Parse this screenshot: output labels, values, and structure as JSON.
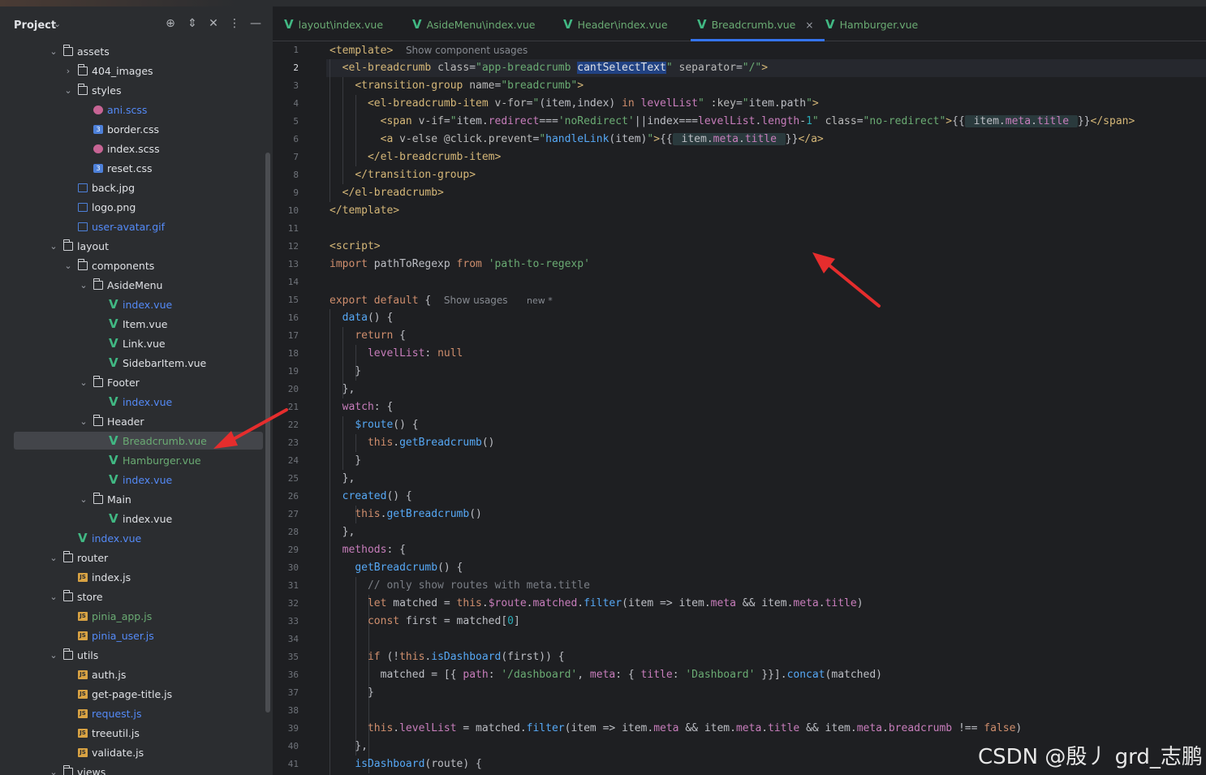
{
  "project": {
    "title": "Project",
    "tree": [
      {
        "label": "assets",
        "kind": "folder",
        "depth": 0,
        "open": true,
        "color": "default"
      },
      {
        "label": "404_images",
        "kind": "folder",
        "depth": 1,
        "open": false,
        "color": "default"
      },
      {
        "label": "styles",
        "kind": "folder",
        "depth": 1,
        "open": true,
        "color": "default"
      },
      {
        "label": "ani.scss",
        "kind": "scss",
        "depth": 2,
        "color": "blue"
      },
      {
        "label": "border.css",
        "kind": "css",
        "depth": 2,
        "color": "default"
      },
      {
        "label": "index.scss",
        "kind": "scss",
        "depth": 2,
        "color": "default"
      },
      {
        "label": "reset.css",
        "kind": "css",
        "depth": 2,
        "color": "default"
      },
      {
        "label": "back.jpg",
        "kind": "img",
        "depth": 1,
        "color": "default"
      },
      {
        "label": "logo.png",
        "kind": "img",
        "depth": 1,
        "color": "default"
      },
      {
        "label": "user-avatar.gif",
        "kind": "img",
        "depth": 1,
        "color": "blue"
      },
      {
        "label": "layout",
        "kind": "folder",
        "depth": 0,
        "open": true,
        "color": "default"
      },
      {
        "label": "components",
        "kind": "folder",
        "depth": 1,
        "open": true,
        "color": "default"
      },
      {
        "label": "AsideMenu",
        "kind": "folder",
        "depth": 2,
        "open": true,
        "color": "default"
      },
      {
        "label": "index.vue",
        "kind": "vue",
        "depth": 3,
        "color": "blue"
      },
      {
        "label": "Item.vue",
        "kind": "vue",
        "depth": 3,
        "color": "default"
      },
      {
        "label": "Link.vue",
        "kind": "vue",
        "depth": 3,
        "color": "default"
      },
      {
        "label": "SidebarItem.vue",
        "kind": "vue",
        "depth": 3,
        "color": "default"
      },
      {
        "label": "Footer",
        "kind": "folder",
        "depth": 2,
        "open": true,
        "color": "default"
      },
      {
        "label": "index.vue",
        "kind": "vue",
        "depth": 3,
        "color": "blue"
      },
      {
        "label": "Header",
        "kind": "folder",
        "depth": 2,
        "open": true,
        "color": "default"
      },
      {
        "label": "Breadcrumb.vue",
        "kind": "vue",
        "depth": 3,
        "color": "green",
        "selected": true
      },
      {
        "label": "Hamburger.vue",
        "kind": "vue",
        "depth": 3,
        "color": "green"
      },
      {
        "label": "index.vue",
        "kind": "vue",
        "depth": 3,
        "color": "blue"
      },
      {
        "label": "Main",
        "kind": "folder",
        "depth": 2,
        "open": true,
        "color": "default"
      },
      {
        "label": "index.vue",
        "kind": "vue",
        "depth": 3,
        "color": "default"
      },
      {
        "label": "index.vue",
        "kind": "vue",
        "depth": 1,
        "color": "blue"
      },
      {
        "label": "router",
        "kind": "folder",
        "depth": 0,
        "open": true,
        "color": "default"
      },
      {
        "label": "index.js",
        "kind": "js",
        "depth": 1,
        "color": "default"
      },
      {
        "label": "store",
        "kind": "folder",
        "depth": 0,
        "open": true,
        "color": "default"
      },
      {
        "label": "pinia_app.js",
        "kind": "js",
        "depth": 1,
        "color": "green"
      },
      {
        "label": "pinia_user.js",
        "kind": "js",
        "depth": 1,
        "color": "blue"
      },
      {
        "label": "utils",
        "kind": "folder",
        "depth": 0,
        "open": true,
        "color": "default"
      },
      {
        "label": "auth.js",
        "kind": "js",
        "depth": 1,
        "color": "default"
      },
      {
        "label": "get-page-title.js",
        "kind": "js",
        "depth": 1,
        "color": "default"
      },
      {
        "label": "request.js",
        "kind": "js",
        "depth": 1,
        "color": "blue"
      },
      {
        "label": "treeutil.js",
        "kind": "js",
        "depth": 1,
        "color": "default"
      },
      {
        "label": "validate.js",
        "kind": "js",
        "depth": 1,
        "color": "default"
      },
      {
        "label": "views",
        "kind": "folder",
        "depth": 0,
        "open": true,
        "color": "default"
      }
    ]
  },
  "tabs": [
    {
      "label": "layout\\index.vue",
      "active": false
    },
    {
      "label": "AsideMenu\\index.vue",
      "active": false
    },
    {
      "label": "Header\\index.vue",
      "active": false
    },
    {
      "label": "Breadcrumb.vue",
      "active": true
    },
    {
      "label": "Hamburger.vue",
      "active": false
    }
  ],
  "tab_close": "×",
  "editor": {
    "current_line": 2,
    "line_count": 41,
    "hints": {
      "template": "Show component usages",
      "export_usages": "Show usages",
      "export_new": "new *"
    }
  },
  "colors": {
    "accent": "#3574f0",
    "vue": "#41b883",
    "arrow": "#e52d2d"
  },
  "watermark": "CSDN @殷丿 grd_志鹏"
}
